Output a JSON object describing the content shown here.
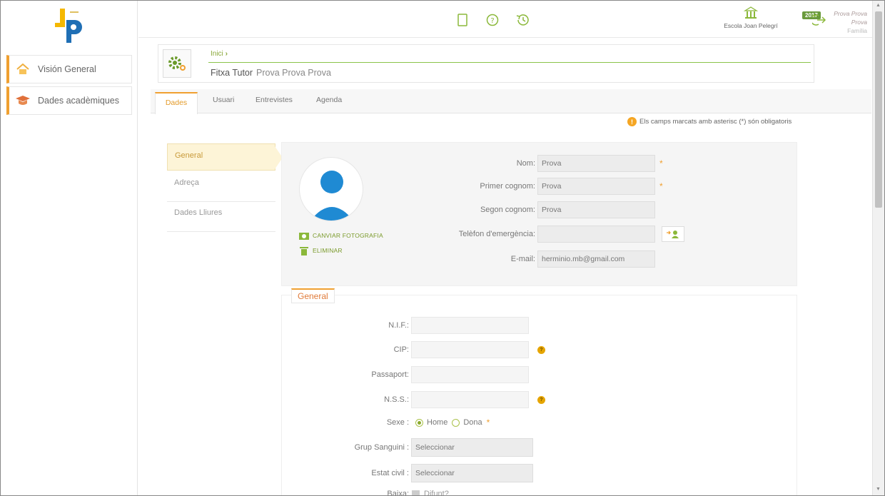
{
  "sidebar": {
    "items": [
      {
        "label": "Visión General",
        "icon": "home-icon"
      },
      {
        "label": "Dades acadèmiques",
        "icon": "graduation-cap-icon"
      }
    ]
  },
  "topbar": {
    "school": "Escola Joan Pelegrí",
    "year": "2017",
    "user_name": "Prova Prova Prova",
    "user_role": "Família"
  },
  "header": {
    "breadcrumb": "Inici",
    "title": "Fitxa Tutor",
    "person": "Prova Prova Prova"
  },
  "tabs": [
    {
      "label": "Dades",
      "active": true
    },
    {
      "label": "Usuari",
      "active": false
    },
    {
      "label": "Entrevistes",
      "active": false
    },
    {
      "label": "Agenda",
      "active": false
    }
  ],
  "notice": "Els camps marcats amb asterisc (*) són obligatoris",
  "subnav": [
    {
      "label": "General",
      "active": true
    },
    {
      "label": "Adreça",
      "active": false
    },
    {
      "label": "Dades Lliures",
      "active": false
    }
  ],
  "profile": {
    "change_photo": "CANVIAR FOTOGRAFIA",
    "delete": "ELIMINAR",
    "fields": [
      {
        "label": "Nom:",
        "value": "Prova",
        "required": true
      },
      {
        "label": "Primer cognom:",
        "value": "Prova",
        "required": true
      },
      {
        "label": "Segon cognom:",
        "value": "Prova",
        "required": false
      },
      {
        "label": "Telèfon d'emergència:",
        "value": "",
        "required": false
      },
      {
        "label": "E-mail:",
        "value": "herminio.mb@gmail.com",
        "required": false
      }
    ]
  },
  "general": {
    "legend": "General",
    "nif_label": "N.I.F.:",
    "cip_label": "CIP:",
    "passport_label": "Passaport:",
    "nss_label": "N.S.S.:",
    "sex_label": "Sexe :",
    "sex_home": "Home",
    "sex_dona": "Dona",
    "blood_label": "Grup Sanguini :",
    "blood_value": "Seleccionar",
    "civil_label": "Estat civil :",
    "civil_value": "Seleccionar",
    "baixa_label": "Baixa:",
    "difunt_label": "Difunt?"
  },
  "colors": {
    "accent": "#f0a030",
    "green": "#8bc34a",
    "avatar_blue": "#1f8ad3"
  }
}
